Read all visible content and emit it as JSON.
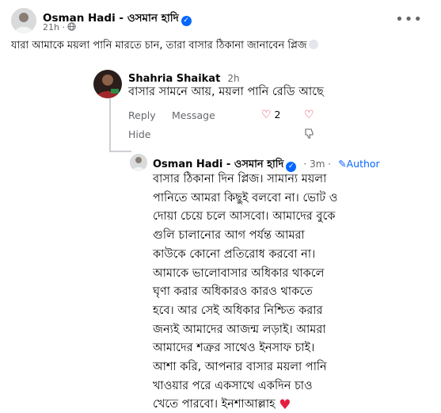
{
  "post": {
    "author": "Osman Hadi - ওসমান হাদি",
    "time": "21h",
    "privacy_icon": "globe-icon",
    "more_icon": "more-options-icon",
    "text": "যারা আমাকে ময়লা পানি মারতে চান, তারা বাসার ঠিকানা জানাবেন প্লিজ"
  },
  "reply1": {
    "author": "Shahria Shaikat",
    "time": "2h",
    "text": "বাসার সামনে আয়, ময়লা পানি রেডি আছে",
    "actions": {
      "reply": "Reply",
      "message": "Message",
      "hide": "Hide",
      "reaction_count": "2"
    }
  },
  "reply2": {
    "author": "Osman Hadi - ওসমান হাদি",
    "time": "3m",
    "badge": "Author",
    "lines": [
      "বাসার ঠিকানা দিন প্লিজ। সামান্য ময়লা",
      "পানিতে আমরা কিছুই বলবো না। ভোট ও",
      "দোয়া চেয়ে চলে আসবো। আমাদের বুকে",
      "গুলি চালানোর আগ পর্যন্ত আমরা",
      "কাউকে কোনো প্রতিরোধ করবো না।",
      "আমাকে ভালোবাসার অধিকার থাকলে",
      "ঘৃণা করার অধিকারও কারও থাকতে",
      "হবে। আর সেই অধিকার নিশ্চিত করার",
      "জন্যই আমাদের আজন্ম লড়াই। আমরা",
      "আমাদের শত্রুর সাথেও ইনসাফ চাই।",
      "আশা করি, আপনার বাসার ময়লা পানি",
      "খাওয়ার পরে একসাথে একদিন চাও",
      "খেতে পারবো। ইনশাআল্লাহ"
    ]
  },
  "colors": {
    "link_blue": "#0866ff",
    "heart_red": "#e41e3f",
    "muted": "#65676b"
  }
}
